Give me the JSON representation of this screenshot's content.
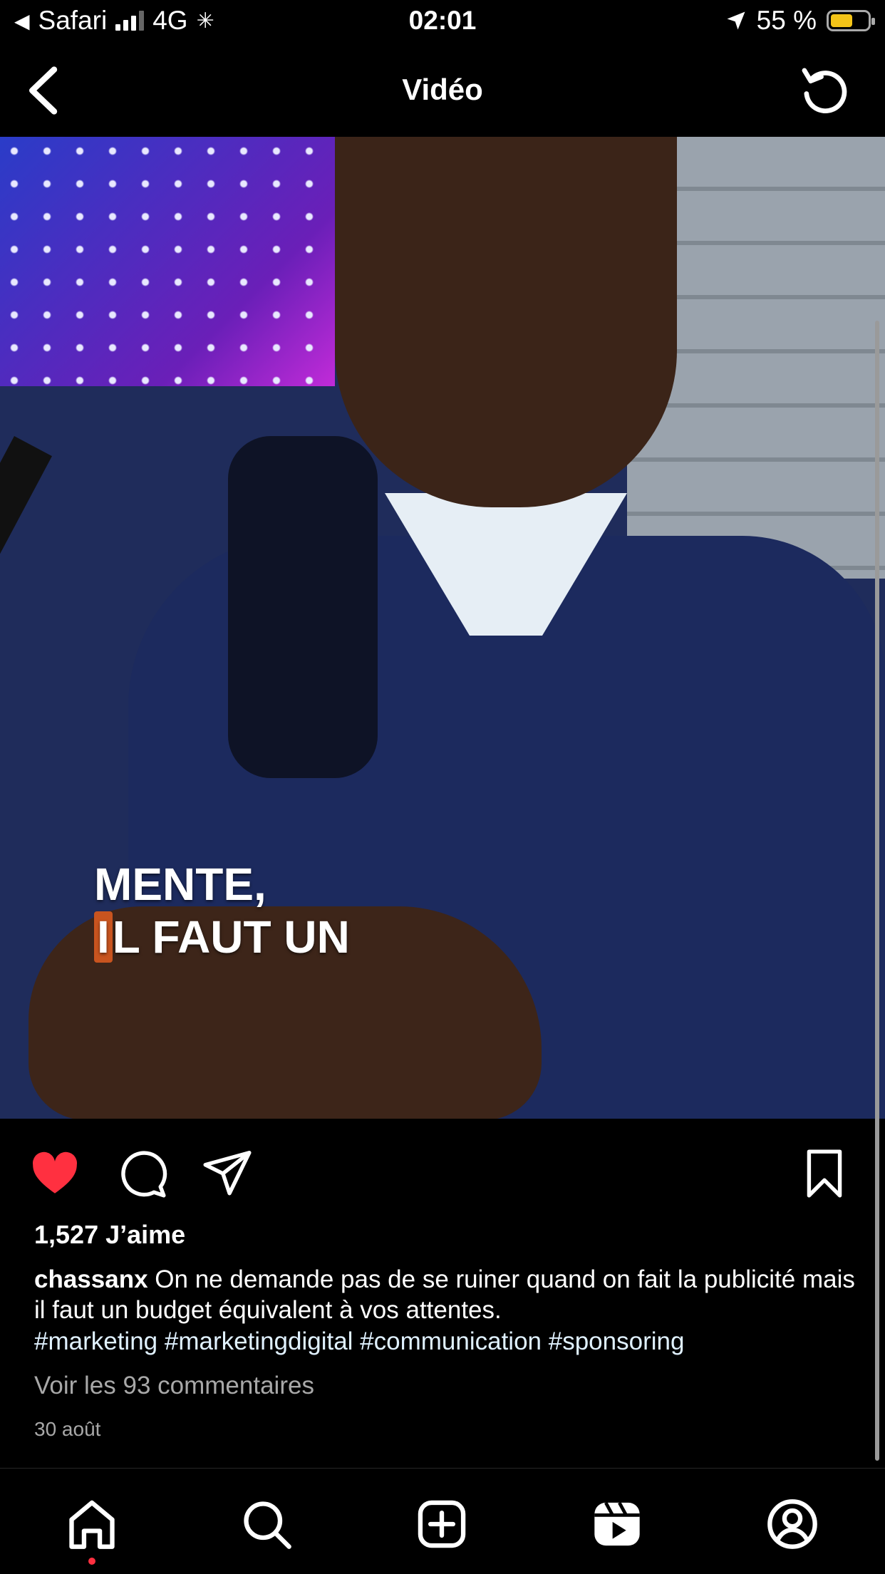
{
  "status_bar": {
    "carrier": "Safari",
    "network": "4G",
    "time": "02:01",
    "battery_percent": "55 %"
  },
  "header": {
    "title": "Vidéo"
  },
  "video": {
    "caption_line1": "MENTE,",
    "caption_hl": "I",
    "caption_line2_rest": "L FAUT UN",
    "muted": true
  },
  "post": {
    "likes": "1,527 J’aime",
    "username": "chassanx",
    "caption": " On ne demande pas de se ruiner quand on fait la publicité mais il faut un budget équivalent à vos attentes.",
    "hashtags": "#marketing #marketingdigital #communication #sponsoring",
    "comments_link": "Voir les 93 commentaires",
    "date": "30 août",
    "liked": true
  },
  "colors": {
    "like_red": "#ff3040",
    "background": "#000000",
    "muted_text": "#a8a8a8",
    "battery_yellow": "#f5c518"
  },
  "icons": [
    "back-icon",
    "reload-icon",
    "heart-icon",
    "comment-icon",
    "share-icon",
    "bookmark-icon",
    "mute-icon",
    "home-icon",
    "search-icon",
    "create-icon",
    "reels-icon",
    "profile-icon"
  ]
}
